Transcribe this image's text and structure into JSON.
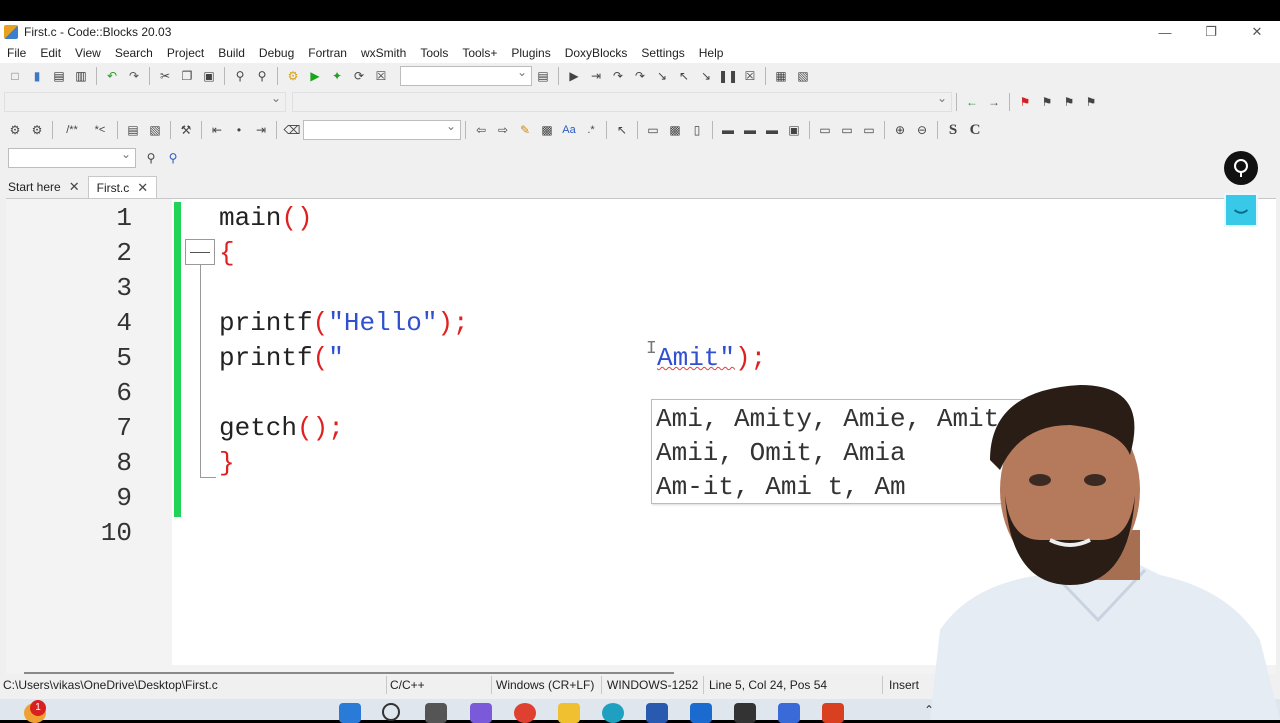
{
  "window": {
    "title": "First.c - Code::Blocks 20.03",
    "minimize_label": "—",
    "restore_label": "❐",
    "close_label": "✕"
  },
  "menu": [
    "File",
    "Edit",
    "View",
    "Search",
    "Project",
    "Build",
    "Debug",
    "Fortran",
    "wxSmith",
    "Tools",
    "Tools+",
    "Plugins",
    "DoxyBlocks",
    "Settings",
    "Help"
  ],
  "tabs": [
    {
      "label": "Start here",
      "close": "✕"
    },
    {
      "label": "First.c",
      "close": "✕"
    }
  ],
  "editor": {
    "line_numbers": [
      "1",
      "2",
      "3",
      "4",
      "5",
      "6",
      "7",
      "8",
      "9",
      "10"
    ],
    "line1": {
      "fn": "main",
      "paren": "()"
    },
    "line2": {
      "brace": "{"
    },
    "line4": {
      "fn": "printf",
      "open": "(",
      "str": "\"Hello\"",
      "close": ");"
    },
    "line5": {
      "fn": "printf",
      "open": "(",
      "str_start": "\""
    },
    "line5b": {
      "str_end": "Amit\"",
      "close": ");"
    },
    "line7": {
      "fn": "getch",
      "call": "();"
    },
    "line8": {
      "brace": "}"
    }
  },
  "spell_suggestions": [
    "Ami, Amity, Amie, Amit",
    "Amii, Omit, Amia",
    "Am-it, Ami t, Am"
  ],
  "status": {
    "path": "C:\\Users\\vikas\\OneDrive\\Desktop\\First.c",
    "language": "C/C++",
    "line_endings": "Windows (CR+LF)",
    "encoding": "WINDOWS-1252",
    "position": "Line 5, Col 24, Pos 54",
    "mode": "Insert"
  },
  "taskbar": {
    "notification_count": "1"
  },
  "colors": {
    "changebar": "#22d35a",
    "operator": "#e02020",
    "string": "#3050d0"
  }
}
